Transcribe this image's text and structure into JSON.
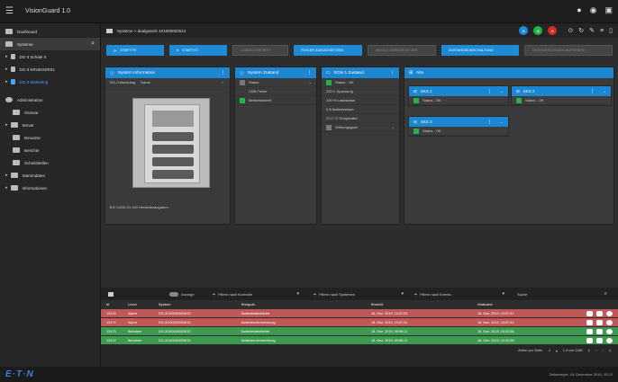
{
  "app": {
    "title": "VisionGuard 1.0",
    "menu_icon": "menu-icon"
  },
  "top_icons": [
    "circle-icon",
    "account-icon",
    "grid-icon"
  ],
  "sidebar": {
    "items": [
      {
        "label": "Dashboard",
        "icon": "dashboard-icon"
      },
      {
        "label": "Systeme",
        "icon": "systems-icon"
      },
      {
        "label": "DG-3 Schale X"
      },
      {
        "label": "DG-3 KRUEGER01"
      },
      {
        "label": "DG-3 Marketing"
      },
      {
        "label": "Administration",
        "icon": "gear-icon"
      },
      {
        "label": "Glossar"
      },
      {
        "label": "Server"
      },
      {
        "label": "Benutzer"
      },
      {
        "label": "Berichte"
      },
      {
        "label": "Schnittstellen"
      },
      {
        "label": "Stammdaten"
      },
      {
        "label": "Informationen"
      }
    ]
  },
  "breadcrumb": {
    "text": "Systeme  >  dualguards 101000002614"
  },
  "status_dots": [
    {
      "label": "0",
      "color": "#1f8ad6"
    },
    {
      "label": "0",
      "color": "#27b14a"
    },
    {
      "label": "0",
      "color": "#d62b2b"
    }
  ],
  "actions": [
    {
      "label": "START FE",
      "enabled": true
    },
    {
      "label": "START KT",
      "enabled": true
    },
    {
      "label": "LADEKUTHIKTEST",
      "enabled": false
    },
    {
      "label": "FEHLER ZURÜCKSETZEN",
      "enabled": true
    },
    {
      "label": "AKKULT ZURÜCKSETZEN",
      "enabled": false
    },
    {
      "label": "ZUSTANDSEINSCHALTUNG",
      "enabled": true
    },
    {
      "label": "DATENAUSLESUNG AUFHEBEN",
      "enabled": false
    }
  ],
  "panels": {
    "sysinfo": {
      "title": "System Information",
      "name_label": "DG-3 Marketing",
      "name_value": "Name",
      "caption": "Ⅱ 5-7x200 Gr 190 Herstellerangaben"
    },
    "syszustand": {
      "title": "System Zustand",
      "rows": [
        "Status",
        "USB Fehler",
        "Betriebsbereit"
      ]
    },
    "usv": {
      "title": "SCM 1 Zustand",
      "rows": [
        "Status - OK",
        "230 V  Spannung",
        "100 %  Ladestatus",
        "0 A  Batteriestrom",
        "27.0 °C  Temperatur",
        "Wirkungsgrad"
      ]
    },
    "altes": {
      "title": "Alte",
      "tiles": [
        {
          "title": "SKS 1",
          "status": "Status - OK"
        },
        {
          "title": "SKS 2",
          "status": "Status - OK"
        },
        {
          "title": "SKS 3",
          "status": "Status - OK"
        }
      ]
    }
  },
  "log": {
    "toggle_label": "Anzeige",
    "filters": [
      "Filtern nach Kontrolle",
      "Filtern nach Systemen",
      "Filtern nach Events"
    ],
    "search_placeholder": "Suche",
    "columns": [
      "Id",
      "Level",
      "System",
      "Ereignis",
      "Erstellt",
      "Geändert"
    ],
    "rows": [
      {
        "id": "12475",
        "level": "Alarm",
        "system": "DG-3/100000002613",
        "event": "Batteriekabelfehler",
        "created": "18. Dez. 2019, 10:57:51",
        "changed": "18. Dez. 2019, 10:57:51",
        "tone": "red"
      },
      {
        "id": "12474",
        "level": "Alarm",
        "system": "DG-3/100000002613",
        "event": "Batterieunterbrechung",
        "created": "18. Dez. 2019, 10:57:51",
        "changed": "18. Dez. 2019, 10:57:51",
        "tone": "red"
      },
      {
        "id": "12473",
        "level": "Behoben",
        "system": "DG-3/100000002613",
        "event": "Batteriekabelfehler",
        "created": "18. Dez. 2019, 09:56:11",
        "changed": "18. Dez. 2019, 10:02:58",
        "tone": "grn"
      },
      {
        "id": "12472",
        "level": "Behoben",
        "system": "DG-3/100000002613",
        "event": "Batterieunterbrechung",
        "created": "18. Dez. 2019, 09:56:11",
        "changed": "18. Dez. 2019, 10:02:58",
        "tone": "grn"
      }
    ],
    "pager": {
      "per_page_label": "Zeilen pro Seite:",
      "per_page": "4",
      "range": "1-4 von 2481"
    }
  },
  "footer": {
    "brand": "E·T·N",
    "note": "Zeitstempel: 18. Dezember 2019, 10:22"
  }
}
